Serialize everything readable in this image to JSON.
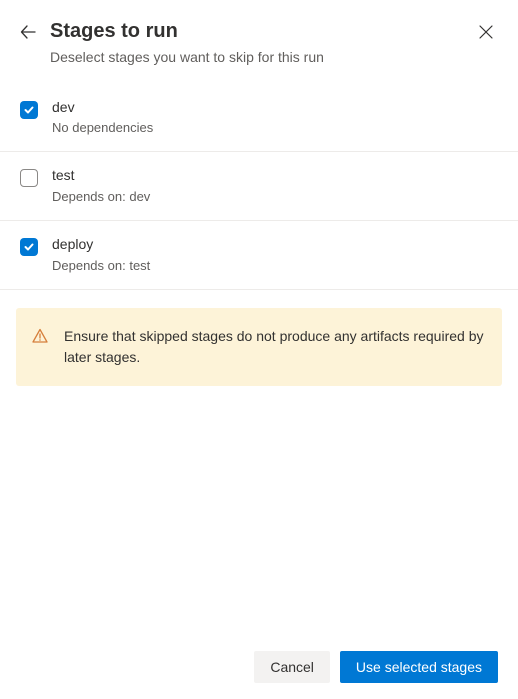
{
  "header": {
    "title": "Stages to run",
    "subtitle": "Deselect stages you want to skip for this run"
  },
  "stages": [
    {
      "name": "dev",
      "dependency": "No dependencies",
      "checked": true
    },
    {
      "name": "test",
      "dependency": "Depends on: dev",
      "checked": false
    },
    {
      "name": "deploy",
      "dependency": "Depends on: test",
      "checked": true
    }
  ],
  "warning": {
    "text": "Ensure that skipped stages do not produce any artifacts required by later stages."
  },
  "footer": {
    "cancel_label": "Cancel",
    "primary_label": "Use selected stages"
  },
  "colors": {
    "primary": "#0078d4",
    "warning_bg": "#fdf3d8",
    "warning_icon": "#d67f3c"
  }
}
